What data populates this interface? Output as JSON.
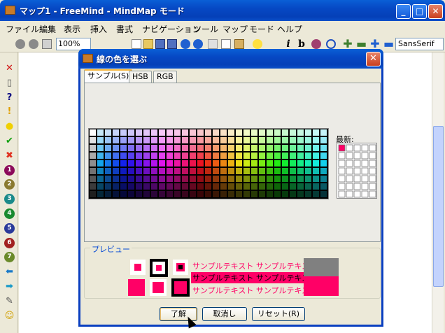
{
  "main_window": {
    "title": "マップ1 - FreeMind - MindMap モード",
    "min_label": "_",
    "max_label": "□",
    "close_label": "✕"
  },
  "menu": [
    "ファイル",
    "編集",
    "表示",
    "挿入",
    "書式",
    "ナビゲーション",
    "ツール",
    "マップ",
    "モード",
    "ヘルプ"
  ],
  "toolbar": {
    "zoom": "100%",
    "font": "SansSerif",
    "icons": [
      "new-icon",
      "open-icon",
      "save-icon",
      "save-as-icon",
      "undo-icon",
      "redo-icon",
      "cut-icon",
      "copy-icon",
      "paste-icon",
      "idea-icon",
      "italic-icon",
      "bold-icon",
      "color-icon",
      "cloud-icon",
      "plus-icon",
      "minus-icon",
      "expand-icon",
      "collapse-icon"
    ],
    "italic_glyph": "i",
    "bold_glyph": "b"
  },
  "left_icons": [
    {
      "name": "remove-icon",
      "glyph": "✕",
      "color": "#d01010"
    },
    {
      "name": "trash-icon",
      "glyph": "▯",
      "color": "#555555"
    },
    {
      "name": "question-icon",
      "glyph": "?",
      "color": "#000080"
    },
    {
      "name": "warning-icon",
      "glyph": "!",
      "color": "#e0a000"
    },
    {
      "name": "bulb-icon",
      "glyph": "●",
      "color": "#f0d000"
    },
    {
      "name": "check-icon",
      "glyph": "✔",
      "color": "#10a010"
    },
    {
      "name": "cross-icon",
      "glyph": "✖",
      "color": "#e03020"
    },
    {
      "name": "priority-1-icon",
      "glyph": "1",
      "color": "#8b0a5a"
    },
    {
      "name": "priority-2-icon",
      "glyph": "2",
      "color": "#8a7a30"
    },
    {
      "name": "priority-3-icon",
      "glyph": "3",
      "color": "#1a8a8a"
    },
    {
      "name": "priority-4-icon",
      "glyph": "4",
      "color": "#1a8a30"
    },
    {
      "name": "priority-5-icon",
      "glyph": "5",
      "color": "#2a3a9a"
    },
    {
      "name": "priority-6-icon",
      "glyph": "6",
      "color": "#a02020"
    },
    {
      "name": "priority-7-icon",
      "glyph": "7",
      "color": "#6a8a2a"
    },
    {
      "name": "arrow-left-icon",
      "glyph": "⬅",
      "color": "#1a7ac8"
    },
    {
      "name": "arrow-right-icon",
      "glyph": "➡",
      "color": "#1a9ac8"
    },
    {
      "name": "pencil-icon",
      "glyph": "✎",
      "color": "#555555"
    },
    {
      "name": "smiley-icon",
      "glyph": "☺",
      "color": "#d0a000"
    }
  ],
  "dialog": {
    "title": "線の色を選ぶ",
    "close_label": "✕",
    "tabs": [
      {
        "label": "サンプル(S)",
        "active": true
      },
      {
        "label": "HSB",
        "active": false
      },
      {
        "label": "RGB",
        "active": false
      }
    ],
    "recent_label": "最新:",
    "recent_selected_color": "#ff0066",
    "preview_label": "プレビュー",
    "preview_color": "#ff0066",
    "sample_text": "サンプルテキスト サンプルテキスト",
    "buttons": {
      "ok": "了解",
      "cancel": "取消し",
      "reset": "リセット(R)"
    }
  }
}
